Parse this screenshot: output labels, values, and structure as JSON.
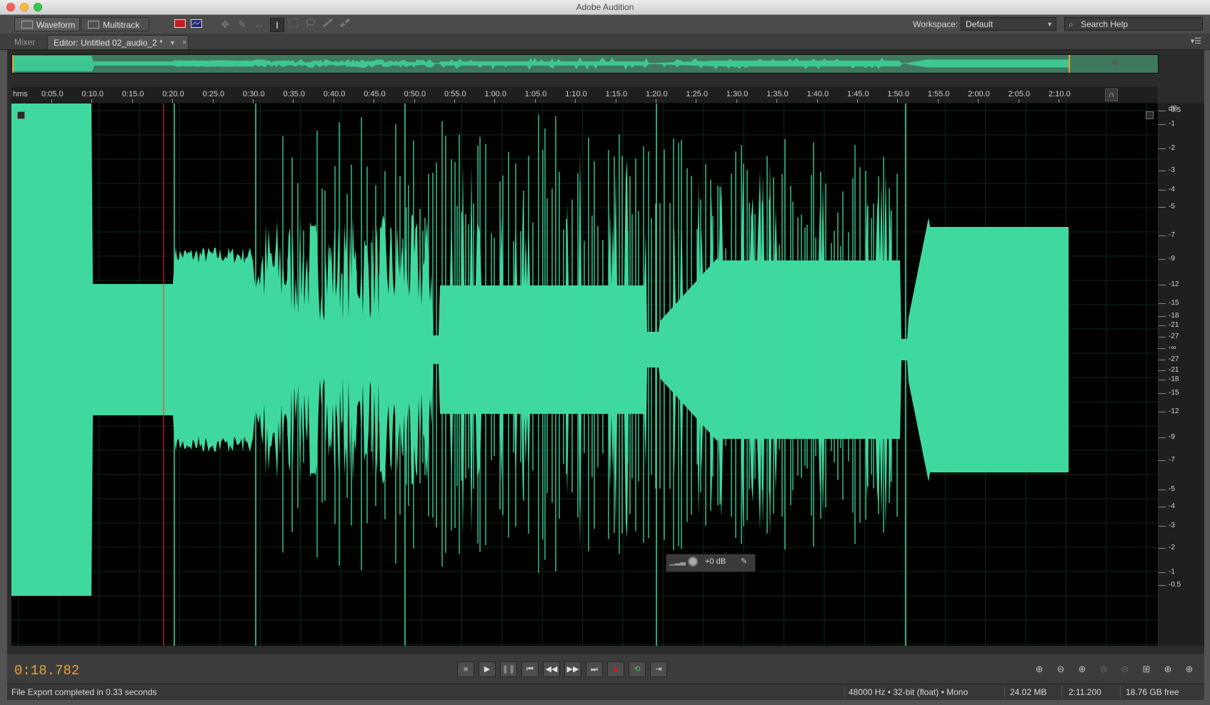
{
  "window": {
    "title": "Adobe Audition"
  },
  "toolbar": {
    "waveform_label": "Waveform",
    "multitrack_label": "Multitrack",
    "workspace_label": "Workspace:",
    "workspace_value": "Default",
    "search_placeholder": "Search Help"
  },
  "tabs": {
    "mixer": "Mixer",
    "editor": "Editor: Untitled 02_audio_2 *"
  },
  "ruler": {
    "unit": "hms",
    "ticks": [
      "0:05.0",
      "0:10.0",
      "0:15.0",
      "0:20.0",
      "0:25.0",
      "0:30.0",
      "0:35.0",
      "0:40.0",
      "0:45.0",
      "0:50.0",
      "0:55.0",
      "1:00.0",
      "1:05.0",
      "1:10.0",
      "1:15.0",
      "1:20.0",
      "1:25.0",
      "1:30.0",
      "1:35.0",
      "1:40.0",
      "1:45.0",
      "1:50.0",
      "1:55.0",
      "2:00.0",
      "2:05.0",
      "2:10.0"
    ]
  },
  "db_scale": {
    "unit": "dB",
    "labels": [
      "-0.5",
      "-1",
      "-2",
      "-3",
      "-4",
      "-5",
      "-7",
      "-9",
      "-12",
      "-15",
      "-18",
      "-21",
      "-27",
      "-∞",
      "-27",
      "-21",
      "-18",
      "-15",
      "-12",
      "-9",
      "-7",
      "-5",
      "-4",
      "-3",
      "-2",
      "-1",
      "-0.5"
    ]
  },
  "hud": {
    "value": "+0 dB"
  },
  "transport": {
    "timecode": "0:18.782"
  },
  "status": {
    "message": "File Export completed in 0.33 seconds",
    "format": "48000 Hz • 32-bit (float) • Mono",
    "size": "24.02 MB",
    "duration": "2:11.200",
    "free": "18.76 GB free"
  },
  "colors": {
    "waveform": "#3fd9a0",
    "playhead": "#ff2a2a",
    "timecode": "#e5a43a",
    "background": "#000000"
  },
  "icons": [
    "waveform-icon",
    "multitrack-icon",
    "spectral-frequency-icon",
    "spectral-pitch-icon",
    "move-tool-icon",
    "razor-tool-icon",
    "slip-tool-icon",
    "time-selection-tool-icon",
    "marquee-tool-icon",
    "lasso-tool-icon",
    "brush-tool-icon",
    "spot-healing-icon",
    "search-icon",
    "panel-menu-icon",
    "zoom-icon",
    "stop-icon",
    "play-icon",
    "pause-icon",
    "skip-to-start-icon",
    "rewind-icon",
    "fast-forward-icon",
    "skip-to-end-icon",
    "record-icon",
    "loop-icon",
    "skip-selection-icon"
  ]
}
